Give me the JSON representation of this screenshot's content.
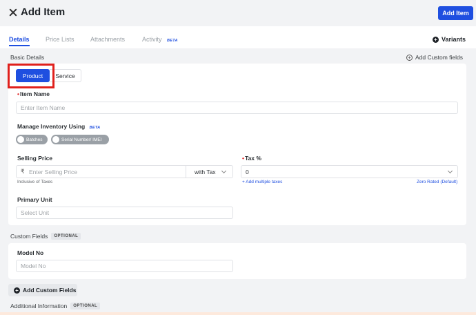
{
  "header": {
    "title": "Add Item",
    "add_button": "Add Item"
  },
  "tabs": [
    {
      "label": "Details",
      "active": true
    },
    {
      "label": "Price Lists"
    },
    {
      "label": "Attachments"
    },
    {
      "label": "Activity",
      "badge": "BETA"
    }
  ],
  "variants_label": "Variants",
  "basic_details": {
    "label": "Basic Details",
    "add_custom_fields": "Add Custom fields",
    "type_options": [
      "Product",
      "Service"
    ],
    "selected_type": "Product",
    "item_name": {
      "label": "Item Name",
      "placeholder": "Enter Item Name",
      "required": true
    },
    "manage_inventory": {
      "label": "Manage Inventory Using",
      "badge": "BETA",
      "toggles": [
        "Batches",
        "Serial Number/ IMEI"
      ]
    },
    "selling_price": {
      "label": "Selling Price",
      "currency_symbol": "₹",
      "placeholder": "Enter Selling Price",
      "tax_mode": "with Tax",
      "hint": "Inclusive of Taxes"
    },
    "tax": {
      "label": "Tax %",
      "required": true,
      "value": "0",
      "add_multiple": "+ Add multiple taxes",
      "zero_rated": "Zero Rated (Default)"
    },
    "primary_unit": {
      "label": "Primary Unit",
      "placeholder": "Select Unit"
    }
  },
  "custom_fields": {
    "label": "Custom Fields",
    "badge": "OPTIONAL",
    "model_no": {
      "label": "Model No",
      "placeholder": "Model No"
    },
    "add_button": "Add Custom Fields"
  },
  "additional_info": {
    "label": "Additional Information",
    "badge": "OPTIONAL"
  },
  "colors": {
    "accent": "#1f4fe0",
    "required": "#e02424",
    "highlight": "#e0201c"
  }
}
